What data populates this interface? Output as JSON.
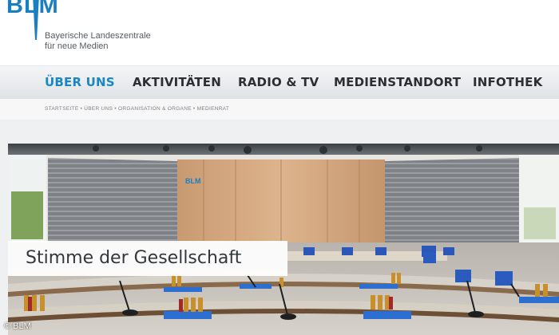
{
  "logo": {
    "text": "BLM"
  },
  "tagline": {
    "line1": "Bayerische Landeszentrale",
    "line2": "für neue Medien"
  },
  "nav": {
    "items": [
      {
        "label": "ÜBER UNS",
        "active": true
      },
      {
        "label": "AKTIVITÄTEN",
        "active": false
      },
      {
        "label": "RADIO & TV",
        "active": false
      },
      {
        "label": "MEDIENSTANDORT",
        "active": false
      },
      {
        "label": "INFOTHEK",
        "active": false
      }
    ]
  },
  "breadcrumb": {
    "text": "STARTSEITE • ÜBER UNS • ORGANISATION & ORGANE • MEDIENRAT"
  },
  "hero": {
    "caption": "Stimme der Gesellschaft",
    "copyright": "© BLM",
    "wall_logo": "BLM"
  },
  "colors": {
    "accent": "#1a86c8",
    "nav_text": "#2b2f33"
  }
}
